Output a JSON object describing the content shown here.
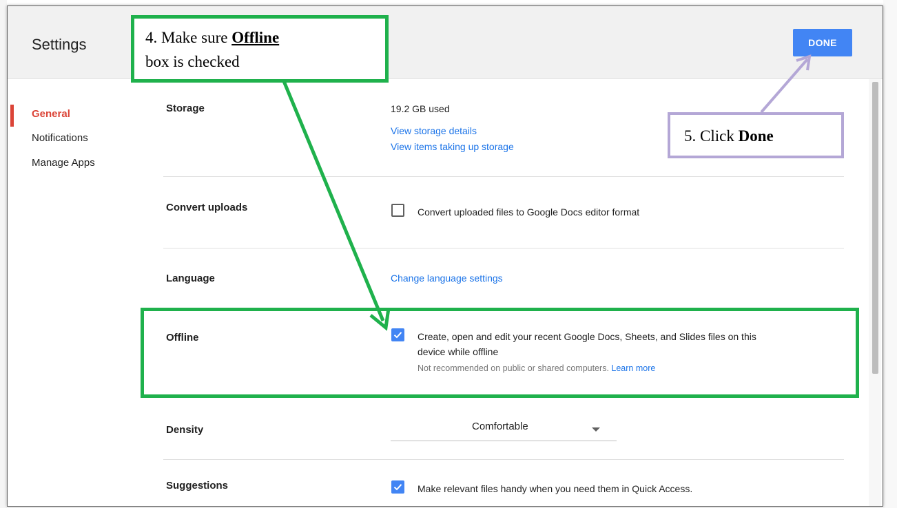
{
  "dialog": {
    "title": "Settings",
    "done_label": "DONE"
  },
  "sidebar": {
    "items": [
      {
        "label": "General",
        "active": true
      },
      {
        "label": "Notifications",
        "active": false
      },
      {
        "label": "Manage Apps",
        "active": false
      }
    ]
  },
  "settings": {
    "storage": {
      "label": "Storage",
      "used": "19.2 GB used",
      "link1": "View storage details",
      "link2": "View items taking up storage"
    },
    "convert": {
      "label": "Convert uploads",
      "checkbox_label": "Convert uploaded files to Google Docs editor format",
      "checked": false
    },
    "language": {
      "label": "Language",
      "link": "Change language settings"
    },
    "offline": {
      "label": "Offline",
      "line1": "Create, open and edit your recent Google Docs, Sheets, and Slides files on this",
      "line2": "device while offline",
      "note": "Not recommended on public or shared computers.",
      "learn_more": "Learn more",
      "checked": true
    },
    "density": {
      "label": "Density",
      "selected": "Comfortable"
    },
    "suggestions": {
      "label": "Suggestions",
      "checkbox_label": "Make relevant files handy when you need them in Quick Access.",
      "checked": true
    }
  },
  "annotations": {
    "step4_prefix": "4. Make sure ",
    "step4_bold": "Offline",
    "step4_suffix": "box is checked",
    "step5_prefix": "5. Click ",
    "step5_bold": "Done",
    "green": "#1fb14c",
    "purple": "#b4a7d6"
  },
  "colors": {
    "accent_blue": "#4285f4",
    "active_red": "#db4437",
    "link_blue": "#1a73e8"
  }
}
